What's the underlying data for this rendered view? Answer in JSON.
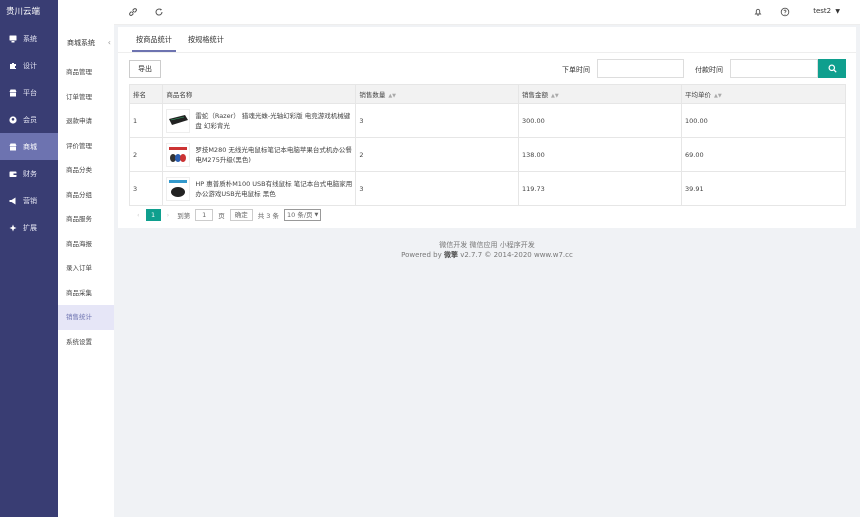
{
  "app": {
    "logo": "贵川云端"
  },
  "sidebar": {
    "items": [
      {
        "label": "系统",
        "icon": "monitor-icon"
      },
      {
        "label": "设计",
        "icon": "puzzle-icon"
      },
      {
        "label": "平台",
        "icon": "store-icon"
      },
      {
        "label": "会员",
        "icon": "user-icon"
      },
      {
        "label": "商城",
        "icon": "shop-icon",
        "active": true
      },
      {
        "label": "财务",
        "icon": "wallet-icon"
      },
      {
        "label": "营销",
        "icon": "megaphone-icon"
      },
      {
        "label": "扩展",
        "icon": "extension-icon"
      }
    ]
  },
  "submenu": {
    "title": "商城系统",
    "items": [
      "商品管理",
      "订单管理",
      "退款申请",
      "评价管理",
      "商品分类",
      "商品分组",
      "商品服务",
      "商品海报",
      "录入订单",
      "商品采集",
      "销售统计",
      "系统设置"
    ],
    "active_index": 10
  },
  "topbar": {
    "username": "test2"
  },
  "tabs": [
    "按商品统计",
    "按规格统计"
  ],
  "toolbar": {
    "export_label": "导出",
    "order_time_label": "下单时间",
    "pay_time_label": "付款时间"
  },
  "table": {
    "headers": [
      "排名",
      "商品名称",
      "销售数量",
      "销售金额",
      "平均单价"
    ],
    "rows": [
      {
        "rank": "1",
        "name": "雷蛇（Razer） 猎魂光蛛-光轴幻彩版 电竞游戏机械键盘 幻彩背光",
        "qty": "3",
        "amount": "300.00",
        "avg": "100.00"
      },
      {
        "rank": "2",
        "name": "罗技M280 无线光电鼠标笔记本电脑苹果台式机办公餐电M275升级(黑色)",
        "qty": "2",
        "amount": "138.00",
        "avg": "69.00"
      },
      {
        "rank": "3",
        "name": "HP 惠普质朴M100 USB有线鼠标 笔记本台式电脑家用办公游戏USB光电鼠标 黑色",
        "qty": "3",
        "amount": "119.73",
        "avg": "39.91"
      }
    ]
  },
  "pager": {
    "prev": "‹",
    "next": "›",
    "current": "1",
    "goto_label": "到第",
    "goto_value": "1",
    "page_unit": "页",
    "confirm_label": "确定",
    "total": "共 3 条",
    "page_size": "10 条/页"
  },
  "footer": {
    "links": "微信开发 微信应用 小程序开发",
    "powered_prefix": "Powered by",
    "brand": "微擎",
    "version": "v2.7.7 © 2014-2020 www.w7.cc"
  },
  "colors": {
    "sidebar": "#393d73",
    "accent": "#6d73b0",
    "primary_button": "#0f9f8e"
  }
}
